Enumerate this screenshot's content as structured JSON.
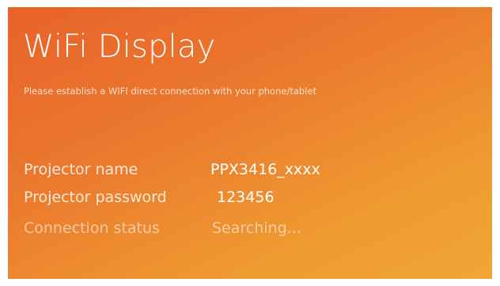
{
  "screen": {
    "title": "WiFi Display",
    "subtitle": "Please establish a WIFI direct connection with your phone/tablet"
  },
  "info": {
    "projector_name_label": "Projector name",
    "projector_name_value": "PPX3416_xxxx",
    "projector_password_label": "Projector password",
    "projector_password_value": "123456",
    "connection_status_label": "Connection status",
    "connection_status_value": "Searching..."
  },
  "colors": {
    "gradient_start": "#e8622a",
    "gradient_end": "#f0a634",
    "text": "#ffffff"
  }
}
